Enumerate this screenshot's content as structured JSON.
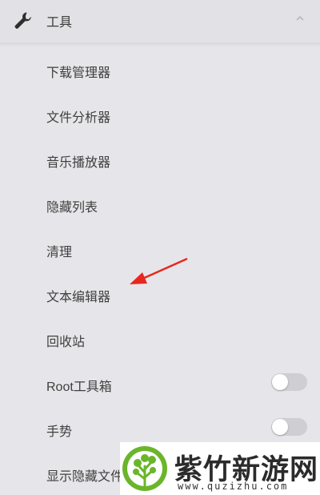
{
  "header": {
    "title": "工具",
    "icon": "wrench-icon",
    "collapse_icon": "chevron-up-icon"
  },
  "menu": {
    "items": [
      {
        "label": "下载管理器"
      },
      {
        "label": "文件分析器"
      },
      {
        "label": "音乐播放器"
      },
      {
        "label": "隐藏列表"
      },
      {
        "label": "清理"
      },
      {
        "label": "文本编辑器"
      },
      {
        "label": "回收站"
      },
      {
        "label": "Root工具箱",
        "toggle": false
      },
      {
        "label": "手势",
        "toggle": false
      },
      {
        "label": "显示隐藏文件"
      }
    ]
  },
  "annotation": {
    "arrow_color": "#e8271e",
    "points_to": "文本编辑器"
  },
  "watermark": {
    "name": "紫竹新游网",
    "url": "www.quzizhu.com",
    "brand_color": "#6bb52b"
  }
}
